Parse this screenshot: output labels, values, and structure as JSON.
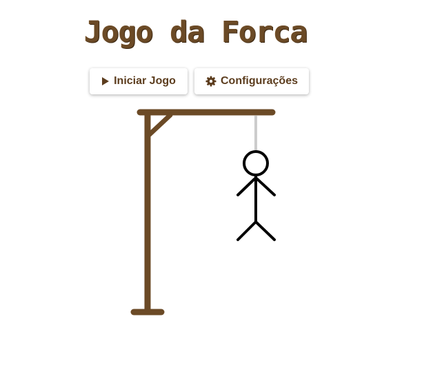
{
  "header": {
    "title": "Jogo da Forca"
  },
  "toolbar": {
    "start_label": "Iniciar Jogo",
    "start_icon": "play-icon",
    "config_label": "Configurações",
    "config_icon": "gear-icon"
  },
  "game": {
    "wrong_guesses_shown": 6,
    "body_parts": [
      "head",
      "body",
      "left-arm",
      "right-arm",
      "left-leg",
      "right-leg"
    ]
  },
  "colors": {
    "brand_brown": "#6b4a26",
    "gallows_wood": "#6b4a26",
    "rope": "#cccccc",
    "stick_figure": "#000000",
    "background": "#ffffff"
  }
}
